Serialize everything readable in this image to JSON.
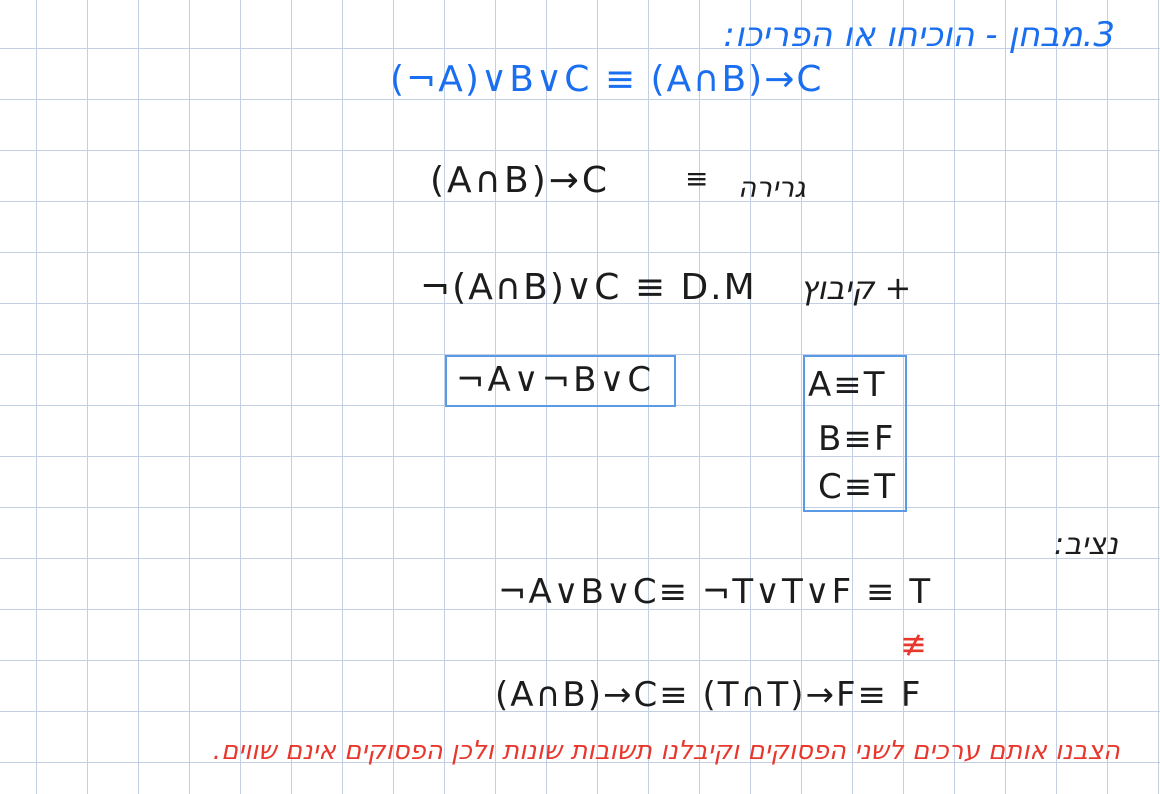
{
  "header": {
    "title": "3.מבחן - הוכיחו או הפריכו:",
    "claim": "(¬A)∨B∨C ≡ (A∩B)→C"
  },
  "lines": {
    "step1_lhs": "(A∩B)→C",
    "step1_eq": "≡",
    "step1_rule": "גרירה",
    "step2_expr": "¬(A∩B)∨C ≡ D.M",
    "step2_rule": "+ קיבוץ",
    "result_box": "¬A∨¬B∨C",
    "assign": [
      "A≡T",
      "B≡F",
      "C≡T"
    ]
  },
  "substitution": {
    "label": "נציב:",
    "line1": "¬A∨B∨C≡ ¬T∨T∨F ≡ T",
    "not_equal": "≢",
    "line2": "(A∩B)→C≡ (T∩T)→F≡ F"
  },
  "conclusion": "הצבנו אותם ערכים לשני הפסוקים וקיבלנו תשובות שונות ולכן הפסוקים אינם שווים."
}
